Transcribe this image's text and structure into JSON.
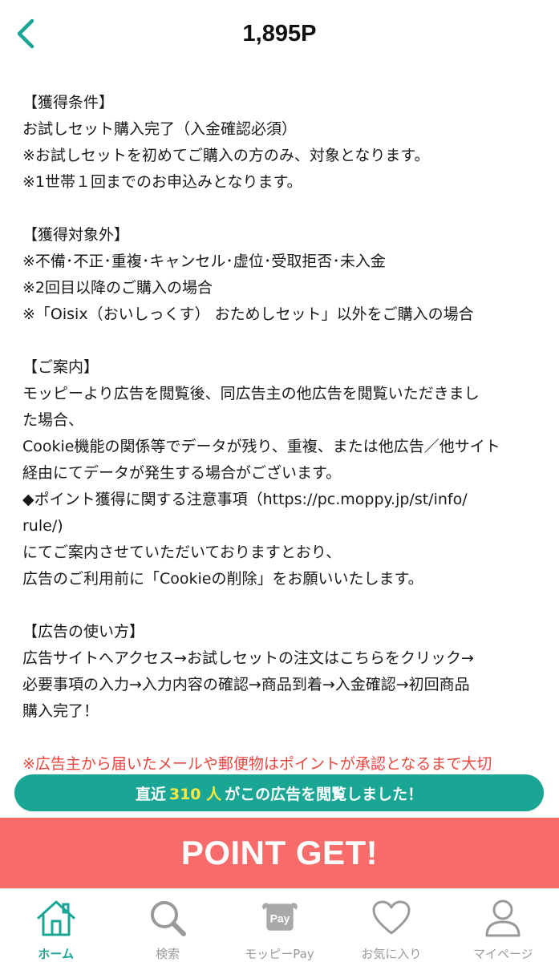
{
  "header": {
    "title": "1,895P"
  },
  "content": {
    "lines": [
      "【獲得条件】",
      "お試しセット購入完了（入金確認必須）",
      "※お試しセットを初めてご購入の方のみ、対象となります。",
      "※1世帯１回までのお申込みとなります。",
      "",
      "【獲得対象外】",
      "※不備･不正･重複･キャンセル･虚位･受取拒否･未入金",
      "※2回目以降のご購入の場合",
      "※「Oisix（おいしっくす） おためしセット」以外をご購入の場合",
      "",
      "【ご案内】",
      "モッピーより広告を閲覧後、同広告主の他広告を閲覧いただきまし",
      "た場合、",
      "Cookie機能の関係等でデータが残り、重複、または他広告／他サイト",
      "経由にてデータが発生する場合がございます。",
      "◆ポイント獲得に関する注意事項（https://pc.moppy.jp/st/info/",
      "rule/)",
      "にてご案内させていただいておりますとおり、",
      "広告のご利用前に「Cookieの削除」をお願いいたします。",
      "",
      "【広告の使い方】",
      "広告サイトへアクセス→お試しセットの注文はこちらをクリック→",
      "必要事項の入力→入力内容の確認→商品到着→入金確認→初回商品",
      "購入完了！",
      ""
    ],
    "warning_line": "※広告主から届いたメールや郵便物はポイントが承認となるまで大切"
  },
  "viewer_banner": {
    "prefix": "直近",
    "count": "310 人",
    "suffix": "がこの広告を閲覧しました！"
  },
  "point_get_label": "POINT GET!",
  "tabbar": {
    "tabs": [
      {
        "label": "ホーム",
        "icon": "home-icon",
        "active": true
      },
      {
        "label": "検索",
        "icon": "search-icon",
        "active": false
      },
      {
        "label": "モッピーPay",
        "icon": "pay-icon",
        "active": false
      },
      {
        "label": "お気に入り",
        "icon": "heart-icon",
        "active": false
      },
      {
        "label": "マイページ",
        "icon": "user-icon",
        "active": false
      }
    ]
  },
  "colors": {
    "accent": "#19a694",
    "point_get": "#f86b6b",
    "warning": "#e8473f",
    "count_highlight": "#ffe840",
    "inactive": "#9a9a9a"
  }
}
